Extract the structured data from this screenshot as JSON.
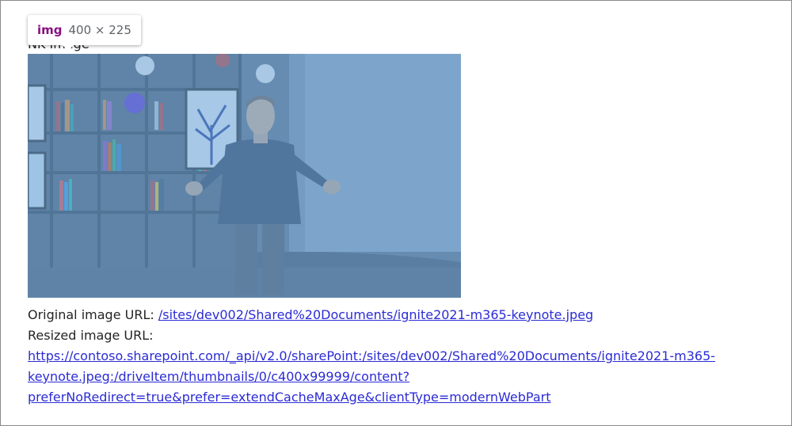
{
  "tooltip": {
    "tag": "img",
    "dimensions": "400 × 225"
  },
  "heading": {
    "text": "N‌K Image"
  },
  "image": {
    "alt": "Keynote speaker on stage in front of bookshelves"
  },
  "info": {
    "original_label": "Original image URL: ",
    "original_url": "/sites/dev002/Shared%20Documents/ignite2021-m365-keynote.jpeg",
    "resized_label": "Resized image URL:",
    "resized_url_line1": "https://contoso.sharepoint.com/_api/v2.0/sharePoint:/sites/dev002/Shared%20Documents/ignite2021-m365-",
    "resized_url_line2": "keynote.jpeg:/driveItem/thumbnails/0/c400x99999/content?",
    "resized_url_line3": "preferNoRedirect=true&prefer=extendCacheMaxAge&clientType=modernWebPart"
  },
  "colors": {
    "highlight": "#6fa8dc",
    "link": "#2b2bd6",
    "tag": "#881280"
  }
}
